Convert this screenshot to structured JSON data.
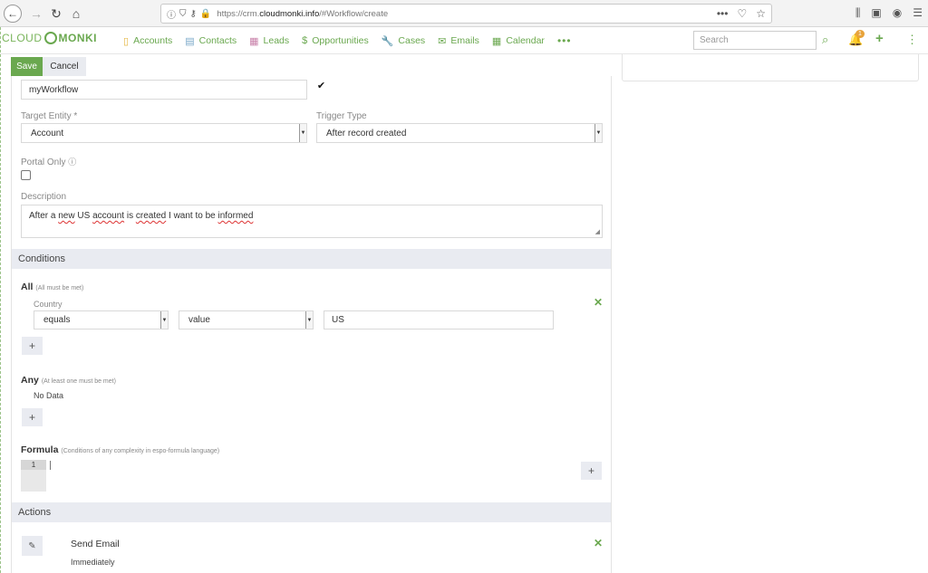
{
  "browser": {
    "url_prefix": "https://crm.",
    "url_domain": "cloudmonki.info",
    "url_path": "/#Workflow/create"
  },
  "app": {
    "logo_left": "CLOUD",
    "logo_right": "MONKI",
    "nav": [
      {
        "label": "Accounts",
        "icon": "building-icon"
      },
      {
        "label": "Contacts",
        "icon": "contact-card-icon"
      },
      {
        "label": "Leads",
        "icon": "id-card-icon"
      },
      {
        "label": "Opportunities",
        "icon": "dollar-icon"
      },
      {
        "label": "Cases",
        "icon": "wrench-icon"
      },
      {
        "label": "Emails",
        "icon": "envelope-icon"
      },
      {
        "label": "Calendar",
        "icon": "calendar-icon"
      }
    ],
    "more": "•••",
    "search_placeholder": "Search",
    "notification_count": "1",
    "accent": "#6aa84f"
  },
  "buttons": {
    "save": "Save",
    "cancel": "Cancel"
  },
  "form": {
    "name_value": "myWorkflow",
    "active_checked": "✔",
    "target_entity_label": "Target Entity *",
    "target_entity_value": "Account",
    "trigger_type_label": "Trigger Type",
    "trigger_type_value": "After record created",
    "portal_only_label": "Portal Only",
    "description_label": "Description",
    "description_parts": [
      "After a ",
      "new",
      " US ",
      "account",
      " is ",
      "created",
      " I want to be ",
      "informed"
    ]
  },
  "conditions": {
    "header": "Conditions",
    "all_title": "All",
    "all_hint": "(All must be met)",
    "field_label": "Country",
    "operator": "equals",
    "value_type": "value",
    "value": "US",
    "any_title": "Any",
    "any_hint": "(At least one must be met)",
    "no_data": "No Data",
    "formula_title": "Formula",
    "formula_hint": "(Conditions of any complexity in espo-formula language)",
    "line_number": "1"
  },
  "actions": {
    "header": "Actions",
    "action_title": "Send Email",
    "action_timing": "Immediately"
  }
}
